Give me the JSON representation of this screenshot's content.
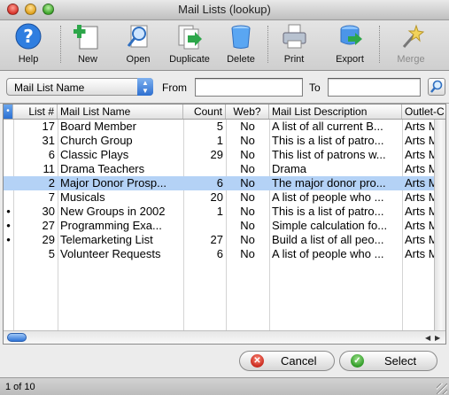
{
  "window": {
    "title": "Mail Lists (lookup)"
  },
  "toolbar": {
    "help": "Help",
    "new": "New",
    "open": "Open",
    "duplicate": "Duplicate",
    "delete": "Delete",
    "print": "Print",
    "export": "Export",
    "merge": "Merge"
  },
  "search": {
    "field_selected": "Mail List Name",
    "from_label": "From",
    "from_value": "",
    "to_label": "To",
    "to_value": ""
  },
  "table": {
    "columns": {
      "mark": "•",
      "list_no": "List #",
      "name": "Mail List Name",
      "count": "Count",
      "web": "Web?",
      "desc": "Mail List Description",
      "outlet": "Outlet-C"
    },
    "rows": [
      {
        "mark": "",
        "id": "17",
        "name": "Board Member",
        "count": "5",
        "web": "No",
        "desc": "A list of all current B...",
        "outlet": "Arts M",
        "selected": false
      },
      {
        "mark": "",
        "id": "31",
        "name": "Church Group",
        "count": "1",
        "web": "No",
        "desc": "This is a list of patro...",
        "outlet": "Arts M",
        "selected": false
      },
      {
        "mark": "",
        "id": "6",
        "name": "Classic Plays",
        "count": "29",
        "web": "No",
        "desc": "This list of patrons w...",
        "outlet": "Arts M",
        "selected": false
      },
      {
        "mark": "",
        "id": "11",
        "name": "Drama Teachers",
        "count": "",
        "web": "No",
        "desc": "Drama",
        "outlet": "Arts M",
        "selected": false
      },
      {
        "mark": "",
        "id": "2",
        "name": "Major Donor Prosp...",
        "count": "6",
        "web": "No",
        "desc": "The major donor pro...",
        "outlet": "Arts M",
        "selected": true
      },
      {
        "mark": "",
        "id": "7",
        "name": "Musicals",
        "count": "20",
        "web": "No",
        "desc": "A list of people who ...",
        "outlet": "Arts M",
        "selected": false
      },
      {
        "mark": "•",
        "id": "30",
        "name": "New Groups in 2002",
        "count": "1",
        "web": "No",
        "desc": "This is a list of patro...",
        "outlet": "Arts M",
        "selected": false
      },
      {
        "mark": "•",
        "id": "27",
        "name": "Programming Exa...",
        "count": "",
        "web": "No",
        "desc": "Simple calculation fo...",
        "outlet": "Arts M",
        "selected": false
      },
      {
        "mark": "•",
        "id": "29",
        "name": "Telemarketing List",
        "count": "27",
        "web": "No",
        "desc": "Build a list of all peo...",
        "outlet": "Arts M",
        "selected": false
      },
      {
        "mark": "",
        "id": "5",
        "name": "Volunteer Requests",
        "count": "6",
        "web": "No",
        "desc": "A list of people who ...",
        "outlet": "Arts M",
        "selected": false
      }
    ]
  },
  "buttons": {
    "cancel": "Cancel",
    "select": "Select"
  },
  "status": {
    "text": "1 of 10"
  },
  "colors": {
    "selection": "#b4d2f6",
    "accent": "#2b6fd1"
  }
}
